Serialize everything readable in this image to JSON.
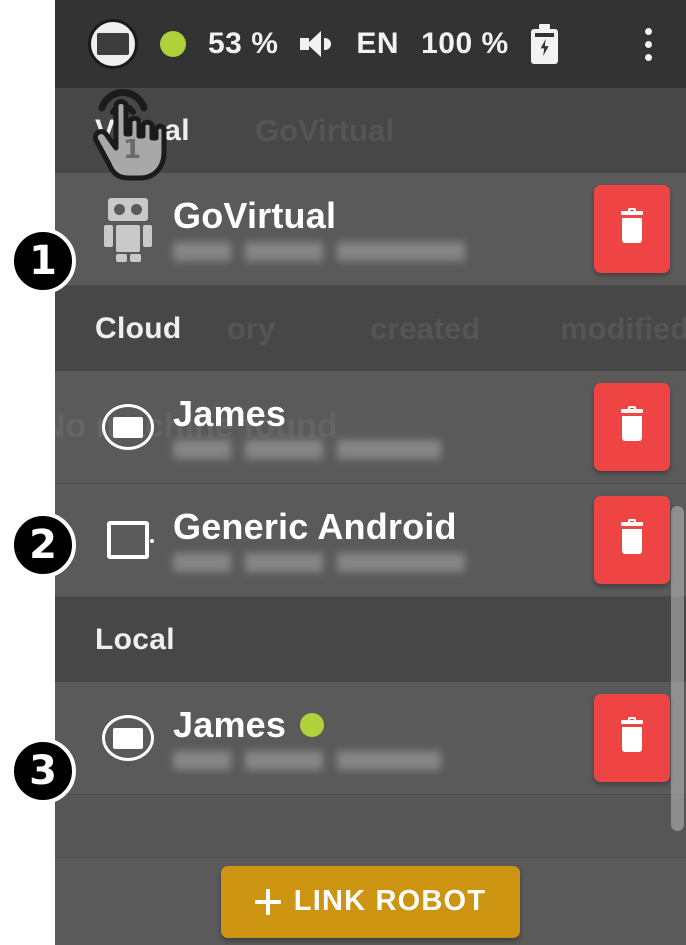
{
  "statusbar": {
    "device_icon": "screen-in-circle-icon",
    "status_dot": "green-status-dot-icon",
    "battery_percent": "53 %",
    "volume_icon": "speaker-icon",
    "language": "EN",
    "secondary_percent": "100 %",
    "charging_icon": "battery-charging-icon",
    "overflow_icon": "kebab-menu-icon",
    "accent_green": "#b1d13a",
    "background": "#333333"
  },
  "ghost_text": {
    "virtual_row": "GoVirtual",
    "cloud_header_a": "ory",
    "cloud_header_b": "created",
    "cloud_header_c": "modified",
    "cloud_row": "No machine found"
  },
  "sections": [
    {
      "id": "virtual",
      "label": "Virtual",
      "devices": [
        {
          "name": "GoVirtual",
          "icon": "robot-icon",
          "subtitle_redacted": true,
          "online": false,
          "delete_label": "Delete"
        }
      ]
    },
    {
      "id": "cloud",
      "label": "Cloud",
      "devices": [
        {
          "name": "James",
          "icon": "screen-in-circle-icon",
          "subtitle_redacted": true,
          "online": false,
          "delete_label": "Delete"
        },
        {
          "name": "Generic Android",
          "icon": "tablet-icon",
          "subtitle_redacted": true,
          "online": false,
          "delete_label": "Delete"
        }
      ]
    },
    {
      "id": "local",
      "label": "Local",
      "devices": [
        {
          "name": "James",
          "icon": "screen-in-circle-icon",
          "subtitle_redacted": true,
          "online": true,
          "delete_label": "Delete"
        }
      ]
    }
  ],
  "footer": {
    "link_robot_label": "LINK ROBOT",
    "link_robot_color": "#cc9411"
  },
  "annotations": {
    "badges": [
      "1",
      "2",
      "3"
    ],
    "cursor": "hand-pointer-cursor"
  },
  "scrollbar": {
    "orientation": "vertical"
  },
  "colors": {
    "panel_bg": "#565656",
    "row_bg": "#5a5a5a",
    "section_bg": "#474747",
    "delete_red": "#ef4444",
    "text_primary": "#ffffff"
  }
}
